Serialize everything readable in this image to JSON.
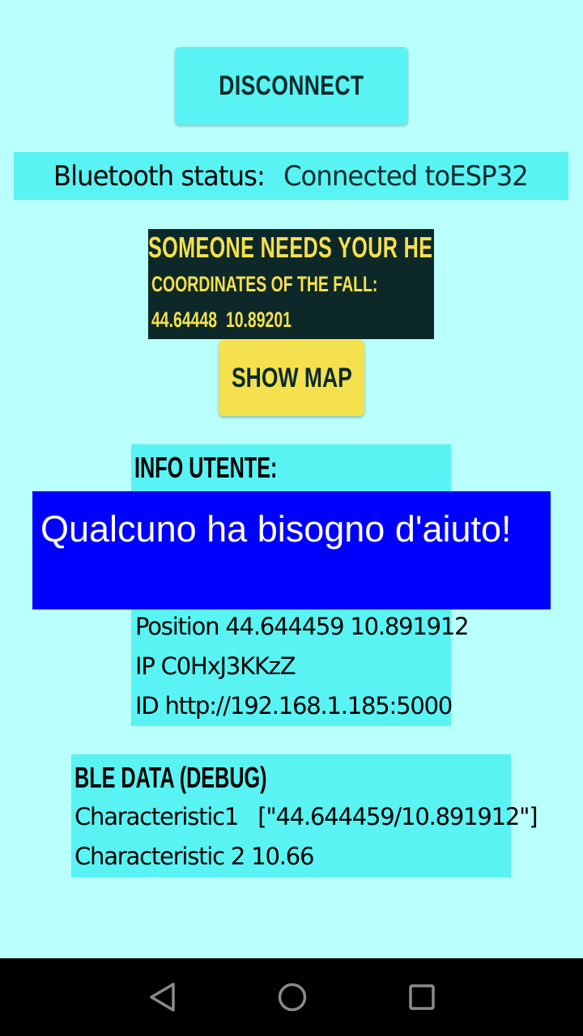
{
  "toolbar": {
    "disconnect_label": "DISCONNECT"
  },
  "bluetooth": {
    "label": "Bluetooth status:",
    "value": "Connected toESP32"
  },
  "alert": {
    "title": "SOMEONE NEEDS YOUR HELP!",
    "coords_label": "COORDINATES OF THE FALL:",
    "coords_value": "44.64448  10.89201"
  },
  "show_map": {
    "label": "SHOW MAP"
  },
  "info": {
    "title": "INFO UTENTE:",
    "position": "Position 44.644459 10.891912",
    "ip": "IP C0HxJ3KKzZ",
    "id": "ID http://192.168.1.185:5000"
  },
  "toast": {
    "message": "Qualcuno ha bisogno d'aiuto!"
  },
  "ble": {
    "title": "BLE DATA (DEBUG)",
    "characteristic1": "Characteristic1   [\"44.644459/10.891912\"]",
    "characteristic2": "Characteristic 2 10.66"
  },
  "navbar": {
    "icons": [
      "back-icon",
      "home-icon",
      "recents-icon"
    ]
  },
  "colors": {
    "background": "#b9fffb",
    "cyan_panel": "#59f3f3",
    "alert_bg": "#0d2828",
    "alert_text": "#f5e04e",
    "toast_bg": "#0000ff"
  }
}
